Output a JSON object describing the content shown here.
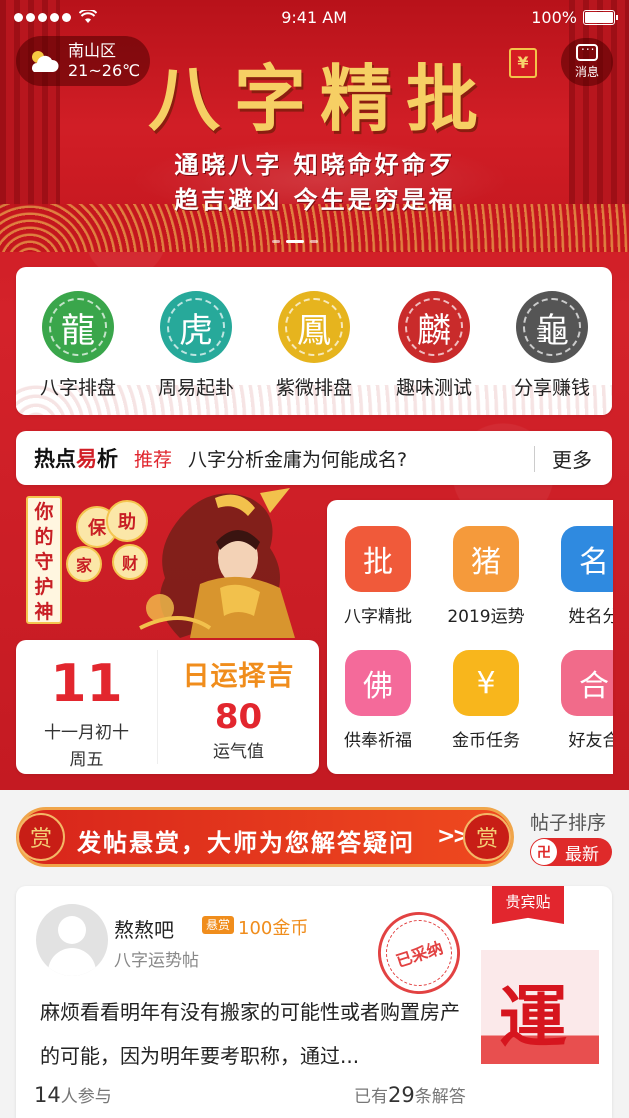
{
  "status_bar": {
    "time": "9:41 AM",
    "battery": "100%",
    "battery_level": 1.0
  },
  "weather": {
    "location": "南山区",
    "temperature": "21~26℃",
    "icon": "cloud-sun-icon"
  },
  "header": {
    "message_label": "消息",
    "redpacket_glyph": "¥"
  },
  "banner": {
    "title": "八字精批",
    "line1": "通晓八字 知晓命好命歹",
    "line2": "趋吉避凶 今生是穷是福",
    "slide_count": 3,
    "active_slide": 2
  },
  "quick_nav": [
    {
      "label": "八字排盘",
      "color": "#3aa64b",
      "glyph": "龍"
    },
    {
      "label": "周易起卦",
      "color": "#27a99a",
      "glyph": "虎"
    },
    {
      "label": "紫微排盘",
      "color": "#e6b41e",
      "glyph": "鳳"
    },
    {
      "label": "趣味测试",
      "color": "#c92b2b",
      "glyph": "麟"
    },
    {
      "label": "分享赚钱",
      "color": "#555555",
      "glyph": "龜"
    }
  ],
  "hot": {
    "title_prefix": "热点",
    "title_accent": "易",
    "title_suffix": "析",
    "tag": "推荐",
    "headline": "八字分析金庸为何能成名?",
    "more": "更多"
  },
  "guardian": {
    "vertical_text": "你的守护神",
    "coins": [
      "保",
      "家",
      "助",
      "财"
    ]
  },
  "almanac": {
    "day": "11",
    "lunar": "十一月初十",
    "weekday": "周五",
    "title": "日运择吉",
    "score": "80",
    "score_label": "运气值"
  },
  "features": [
    {
      "label": "八字精批",
      "color": "#f05a3a",
      "glyph": "批"
    },
    {
      "label": "2019运势",
      "color": "#f59a3b",
      "glyph": "猪"
    },
    {
      "label": "姓名分",
      "color": "#2f8ae0",
      "glyph": "名"
    },
    {
      "label": "供奉祈福",
      "color": "#f46a9a",
      "glyph": "佛"
    },
    {
      "label": "金币任务",
      "color": "#f8b61c",
      "glyph": "¥"
    },
    {
      "label": "好友合",
      "color": "#f16b8a",
      "glyph": "合"
    }
  ],
  "reward_banner": {
    "left_glyph": "赏",
    "right_glyph": "赏",
    "text": "发帖悬赏，大师为您解答疑问",
    "arrows": ">>>>"
  },
  "sort": {
    "label": "帖子排序",
    "button": "最新",
    "icon_glyph": "卍"
  },
  "post": {
    "user": "熬熬吧",
    "badge": "悬赏",
    "coins": "100金币",
    "category": "八字运势帖",
    "stamp": "已采纳",
    "vip": "贵宾贴",
    "body": "麻烦看看明年有没有搬家的可能性或者购置房产的可能，因为明年要考职称，通过...",
    "thumb_char": "運",
    "participants": "14",
    "participants_suffix": "人参与",
    "answers_prefix": "已有",
    "answers": "29",
    "answers_suffix": "条解答"
  }
}
